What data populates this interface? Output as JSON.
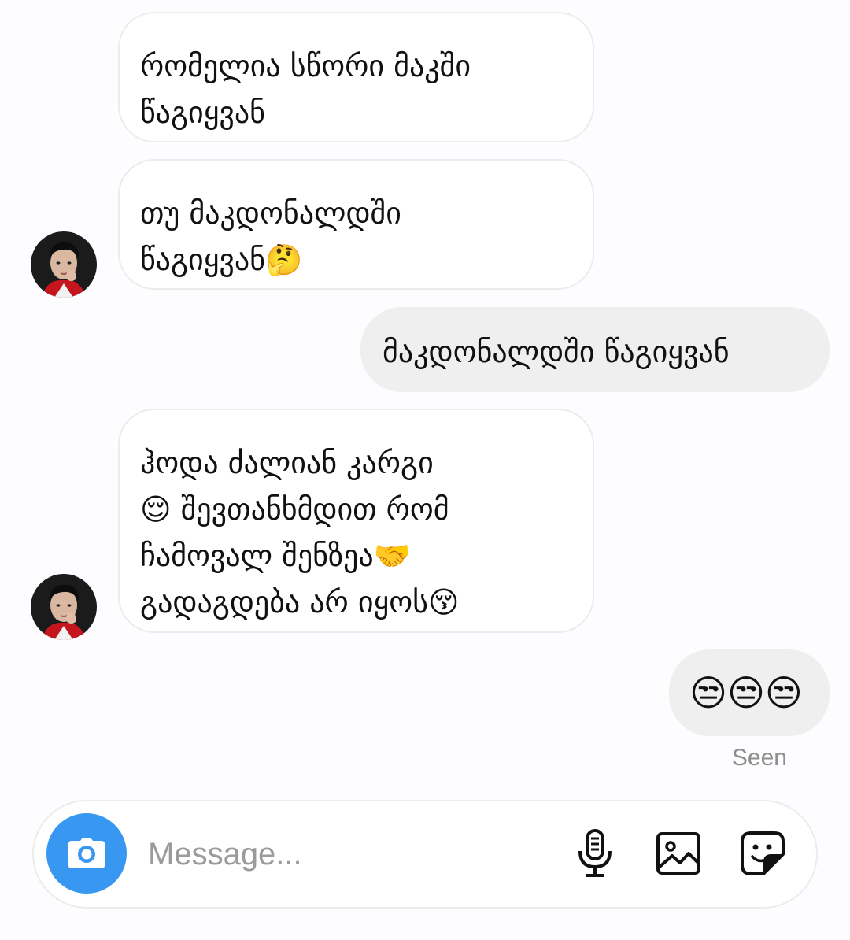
{
  "messages": [
    {
      "direction": "incoming",
      "text": "რომელია სწორი მაკში\nწაგიყვან"
    },
    {
      "direction": "incoming",
      "text": "თუ მაკდონალდში\nწაგიყვან🤔"
    },
    {
      "direction": "outgoing",
      "text": "მაკდონალდში წაგიყვან"
    },
    {
      "direction": "incoming",
      "text": "ჰოდა ძალიან კარგი\n😌 შევთანხმდით რომ\nჩამოვალ შენზეა🤝\nგადაგდება არ იყოს😚"
    },
    {
      "direction": "outgoing",
      "text": "😒😒😒"
    }
  ],
  "seen_label": "Seen",
  "composer": {
    "placeholder": "Message..."
  },
  "icons": {
    "camera": "camera-icon",
    "microphone": "microphone-icon",
    "gallery": "gallery-icon",
    "sticker": "sticker-icon"
  },
  "colors": {
    "accent": "#3897f0",
    "incoming_bubble": "#ffffff",
    "outgoing_bubble": "#efefef",
    "seen_text": "#8e8e8e"
  }
}
